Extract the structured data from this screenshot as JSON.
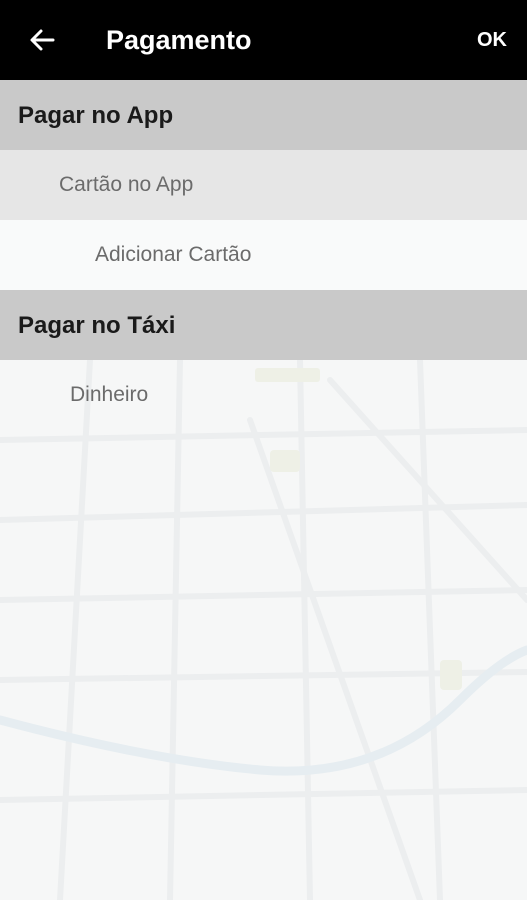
{
  "header": {
    "title": "Pagamento",
    "ok_label": "OK",
    "back_icon": "arrow-left-icon"
  },
  "sections": [
    {
      "label": "Pagar no App",
      "items": [
        {
          "label": "Cartão no App"
        },
        {
          "label": "Adicionar Cartão"
        }
      ]
    },
    {
      "label": "Pagar no Táxi",
      "items": [
        {
          "label": "Dinheiro"
        }
      ]
    }
  ],
  "colors": {
    "header_bg": "#000000",
    "section_bg": "#c9c9c9",
    "subitem_bg": "#e6e6e6"
  }
}
